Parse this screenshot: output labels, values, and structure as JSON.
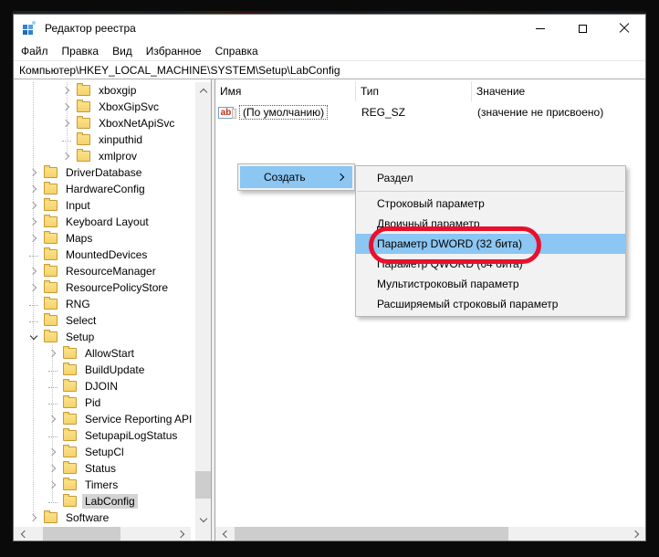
{
  "colors": {
    "menu_highlight": "#8cc6f2",
    "annotation_red": "#e8112d",
    "selection_gray": "#d4d4d4",
    "folder_yellow": "#f5d26d"
  },
  "window": {
    "title": "Редактор реестра"
  },
  "menu_bar": {
    "items": [
      {
        "label": "Файл"
      },
      {
        "label": "Правка"
      },
      {
        "label": "Вид"
      },
      {
        "label": "Избранное"
      },
      {
        "label": "Справка"
      }
    ]
  },
  "address_bar": {
    "value": "Компьютер\\HKEY_LOCAL_MACHINE\\SYSTEM\\Setup\\LabConfig"
  },
  "tree": {
    "items": [
      {
        "label": "xboxgip",
        "level": 3,
        "state": "collapsed"
      },
      {
        "label": "XboxGipSvc",
        "level": 3,
        "state": "collapsed"
      },
      {
        "label": "XboxNetApiSvc",
        "level": 3,
        "state": "collapsed"
      },
      {
        "label": "xinputhid",
        "level": 3,
        "state": "leaf"
      },
      {
        "label": "xmlprov",
        "level": 3,
        "state": "collapsed"
      },
      {
        "label": "DriverDatabase",
        "level": 1,
        "state": "collapsed"
      },
      {
        "label": "HardwareConfig",
        "level": 1,
        "state": "collapsed"
      },
      {
        "label": "Input",
        "level": 1,
        "state": "collapsed"
      },
      {
        "label": "Keyboard Layout",
        "level": 1,
        "state": "collapsed"
      },
      {
        "label": "Maps",
        "level": 1,
        "state": "collapsed"
      },
      {
        "label": "MountedDevices",
        "level": 1,
        "state": "leaf"
      },
      {
        "label": "ResourceManager",
        "level": 1,
        "state": "collapsed"
      },
      {
        "label": "ResourcePolicyStore",
        "level": 1,
        "state": "collapsed"
      },
      {
        "label": "RNG",
        "level": 1,
        "state": "leaf"
      },
      {
        "label": "Select",
        "level": 1,
        "state": "leaf"
      },
      {
        "label": "Setup",
        "level": 1,
        "state": "expanded"
      },
      {
        "label": "AllowStart",
        "level": 2,
        "state": "collapsed"
      },
      {
        "label": "BuildUpdate",
        "level": 2,
        "state": "leaf"
      },
      {
        "label": "DJOIN",
        "level": 2,
        "state": "leaf"
      },
      {
        "label": "Pid",
        "level": 2,
        "state": "leaf"
      },
      {
        "label": "Service Reporting API",
        "level": 2,
        "state": "collapsed"
      },
      {
        "label": "SetupapiLogStatus",
        "level": 2,
        "state": "leaf"
      },
      {
        "label": "SetupCl",
        "level": 2,
        "state": "collapsed"
      },
      {
        "label": "Status",
        "level": 2,
        "state": "collapsed"
      },
      {
        "label": "Timers",
        "level": 2,
        "state": "collapsed"
      },
      {
        "label": "LabConfig",
        "level": 2,
        "state": "leaf",
        "selected": true
      },
      {
        "label": "Software",
        "level": 1,
        "state": "collapsed"
      }
    ]
  },
  "list": {
    "columns": [
      {
        "label": "Имя"
      },
      {
        "label": "Тип"
      },
      {
        "label": "Значение"
      }
    ],
    "rows": [
      {
        "icon_text": "ab",
        "name": "(По умолчанию)",
        "type": "REG_SZ",
        "value": "(значение не присвоено)",
        "focused": true
      }
    ]
  },
  "context_menu": {
    "items": [
      {
        "label": "Создать",
        "has_submenu": true,
        "highlighted": true
      }
    ]
  },
  "submenu": {
    "items": [
      {
        "label": "Раздел"
      },
      {
        "separator": true
      },
      {
        "label": "Строковый параметр"
      },
      {
        "label": "Двоичный параметр"
      },
      {
        "label": "Параметр DWORD (32 бита)",
        "highlighted": true
      },
      {
        "label": "Параметр QWORD (64 бита)"
      },
      {
        "label": "Мультистроковый параметр"
      },
      {
        "label": "Расширяемый строковый параметр"
      }
    ]
  }
}
